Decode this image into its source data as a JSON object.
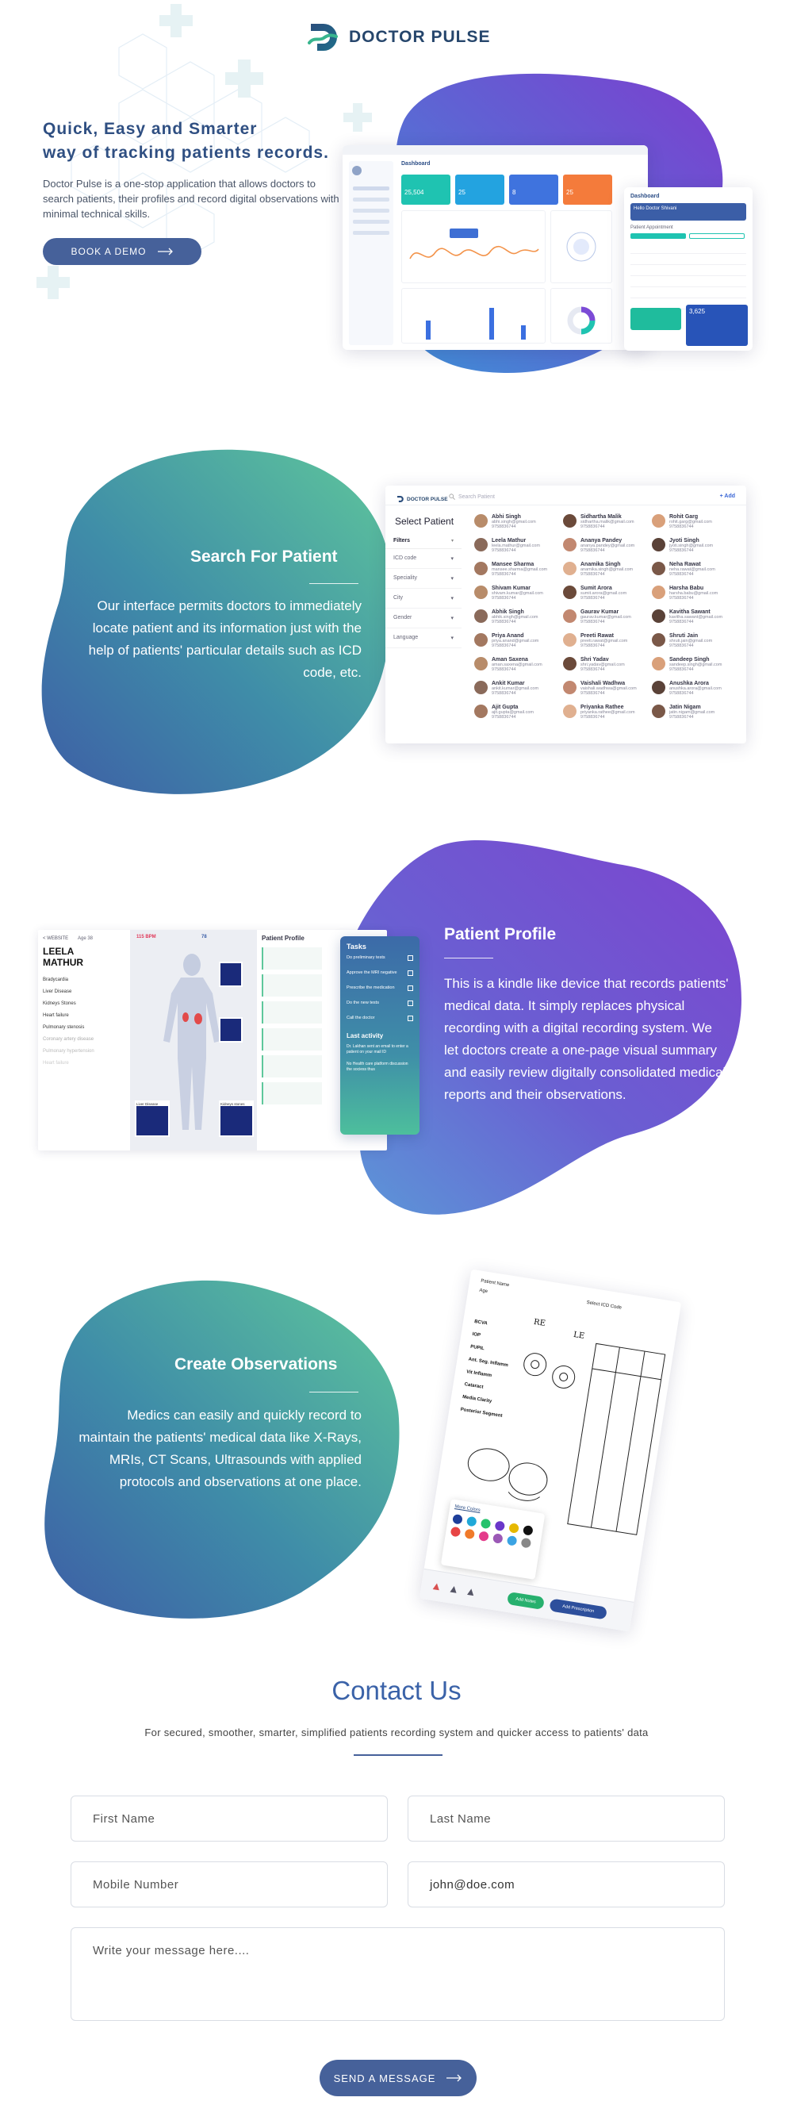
{
  "header": {
    "brand": "DOCTOR PULSE"
  },
  "hero": {
    "title_line1": "Quick, Easy and Smarter",
    "title_line2": "way of tracking patients records.",
    "description": "Doctor Pulse is a one-stop application that allows doctors to search patients, their profiles and record digital observations with minimal technical skills.",
    "cta": "BOOK A DEMO",
    "dashboard_title": "Dashboard",
    "stat1": "25,504",
    "stat2": "25",
    "stat3": "8",
    "stat4": "25",
    "tablet_title": "Dashboard",
    "tablet_banner": "Hello Doctor Shivani",
    "tablet_patients": "Patient Appointment",
    "tablet_stat": "3,625"
  },
  "search": {
    "title": "Search For Patient",
    "body": "Our interface permits doctors to immediately locate patient and its information just with the help of patients' particular details such as ICD code, etc.",
    "panel_brand": "DOCTOR PULSE",
    "panel_search_placeholder": "Search Patient",
    "panel_add": "+ Add",
    "panel_heading": "Select Patient",
    "filters_label": "Filters",
    "filters": [
      "ICD code",
      "Speciality",
      "City",
      "Gender",
      "Language"
    ],
    "patients": [
      {
        "name": "Abhi Singh",
        "email": "abhi.singh@gmail.com",
        "phone": "9758836744"
      },
      {
        "name": "Sidhartha Malik",
        "email": "sidhartha.malik@gmail.com",
        "phone": "9758836744"
      },
      {
        "name": "Rohit Garg",
        "email": "rohit.garg@gmail.com",
        "phone": "9758836744"
      },
      {
        "name": "Leela Mathur",
        "email": "leela.mathur@gmail.com",
        "phone": "9758836744"
      },
      {
        "name": "Ananya Pandey",
        "email": "ananya.pandey@gmail.com",
        "phone": "9758836744"
      },
      {
        "name": "Jyoti Singh",
        "email": "jyoti.singh@gmail.com",
        "phone": "9758836744"
      },
      {
        "name": "Mansee Sharma",
        "email": "mansee.sharma@gmail.com",
        "phone": "9758836744"
      },
      {
        "name": "Anamika Singh",
        "email": "anamika.singh@gmail.com",
        "phone": "9758836744"
      },
      {
        "name": "Neha Rawat",
        "email": "neha.rawat@gmail.com",
        "phone": "9758836744"
      },
      {
        "name": "Shivam Kumar",
        "email": "shivam.kumar@gmail.com",
        "phone": "9758836744"
      },
      {
        "name": "Sumit Arora",
        "email": "sumit.arora@gmail.com",
        "phone": "9758836744"
      },
      {
        "name": "Harsha Babu",
        "email": "harsha.babu@gmail.com",
        "phone": "9758836744"
      },
      {
        "name": "Abhik Singh",
        "email": "abhik.singh@gmail.com",
        "phone": "9758836744"
      },
      {
        "name": "Gaurav Kumar",
        "email": "gaurav.kumar@gmail.com",
        "phone": "9758836744"
      },
      {
        "name": "Kavitha Sawant",
        "email": "kavitha.sawant@gmail.com",
        "phone": "9758836744"
      },
      {
        "name": "Priya Anand",
        "email": "priya.anand@gmail.com",
        "phone": "9758836744"
      },
      {
        "name": "Preeti Rawat",
        "email": "preeti.rawat@gmail.com",
        "phone": "9758836744"
      },
      {
        "name": "Shruti Jain",
        "email": "shruti.jain@gmail.com",
        "phone": "9758836744"
      },
      {
        "name": "Aman Saxena",
        "email": "aman.saxena@gmail.com",
        "phone": "9758836744"
      },
      {
        "name": "Shri Yadav",
        "email": "shri.yadav@gmail.com",
        "phone": "9758836744"
      },
      {
        "name": "Sandeep Singh",
        "email": "sandeep.singh@gmail.com",
        "phone": "9758836744"
      },
      {
        "name": "Ankit Kumar",
        "email": "ankit.kumar@gmail.com",
        "phone": "9758836744"
      },
      {
        "name": "Vaishali Wadhwa",
        "email": "vaishali.wadhwa@gmail.com",
        "phone": "9758836744"
      },
      {
        "name": "Anushka Arora",
        "email": "anushka.arora@gmail.com",
        "phone": "9758836744"
      },
      {
        "name": "Ajit Gupta",
        "email": "ajit.gupta@gmail.com",
        "phone": "9758836744"
      },
      {
        "name": "Priyanka Rathee",
        "email": "priyanka.rathee@gmail.com",
        "phone": "9758836744"
      },
      {
        "name": "Jatin Nigam",
        "email": "jatin.nigam@gmail.com",
        "phone": "9758836744"
      }
    ]
  },
  "profile": {
    "title": "Patient Profile",
    "body": "This is a kindle like device that records patients' medical data. It simply replaces physical recording with a digital recording system. We let doctors create a one-page visual summary and easily review digitally consolidated medical reports and their observations.",
    "panel_back": "< WEBSITE",
    "patient_first": "LEELA",
    "patient_last": "MATHUR",
    "age_label": "Age 38",
    "bpm": "115 BPM",
    "bp": "78",
    "conditions": [
      "Bradycardia",
      "Liver Disease",
      "Kidneys Stones",
      "Heart failure",
      "Pulmonary stenosis",
      "Coronary artery disease",
      "Pulmonary hypertension",
      "Heart failure"
    ],
    "profile_heading": "Patient Profile",
    "scan1": "Liver Disease",
    "scan2": "Kidneys stones",
    "tasks_title": "Tasks",
    "tasks": [
      "Do preliminary tests",
      "Approve the MRI negative",
      "Prescribe the medication",
      "Do the new tests",
      "Call the doctor"
    ],
    "activity_title": "Last activity",
    "activity": [
      "Dr. Lakhan sent an email to enter a patient on your mail ID",
      "No Health care platform discussion the sociess thus"
    ]
  },
  "observations": {
    "title": "Create Observations",
    "body": "Medics can easily and quickly record to maintain the patients' medical data like X-Rays, MRIs, CT Scans, Ultrasounds with applied protocols and observations at one place.",
    "sheet_name": "Patient Name",
    "sheet_age": "Age",
    "sheet_icd": "Select ICD Code",
    "rows": [
      "BCVA",
      "IOP",
      "PUPIL",
      "Ant. Seg. Inflamm",
      "Vit Inflamm",
      "Cataract",
      "Media Clarity",
      "Posterior Segment"
    ],
    "re": "RE",
    "le": "LE",
    "more_colors": "More Colors",
    "btn_notes": "Add Notes",
    "btn_prescription": "Add Prescription"
  },
  "contact": {
    "title": "Contact Us",
    "subtitle": "For secured, smoother, smarter, simplified patients recording system and quicker access to patients' data",
    "first_name": "First Name",
    "last_name": "Last Name",
    "mobile": "Mobile Number",
    "email": "john@doe.com",
    "message": "Write your message here....",
    "send": "SEND A MESSAGE"
  },
  "colors": {
    "brand": "#26466c",
    "button": "#46619a",
    "teal": "#5ec79b",
    "purple": "#7a4fd0",
    "contact_title": "#3a62a8"
  },
  "icons": [
    "logo-icon",
    "arrow-right-icon",
    "search-icon",
    "chevron-right-icon",
    "checkbox-icon",
    "mail-icon",
    "phone-icon"
  ]
}
